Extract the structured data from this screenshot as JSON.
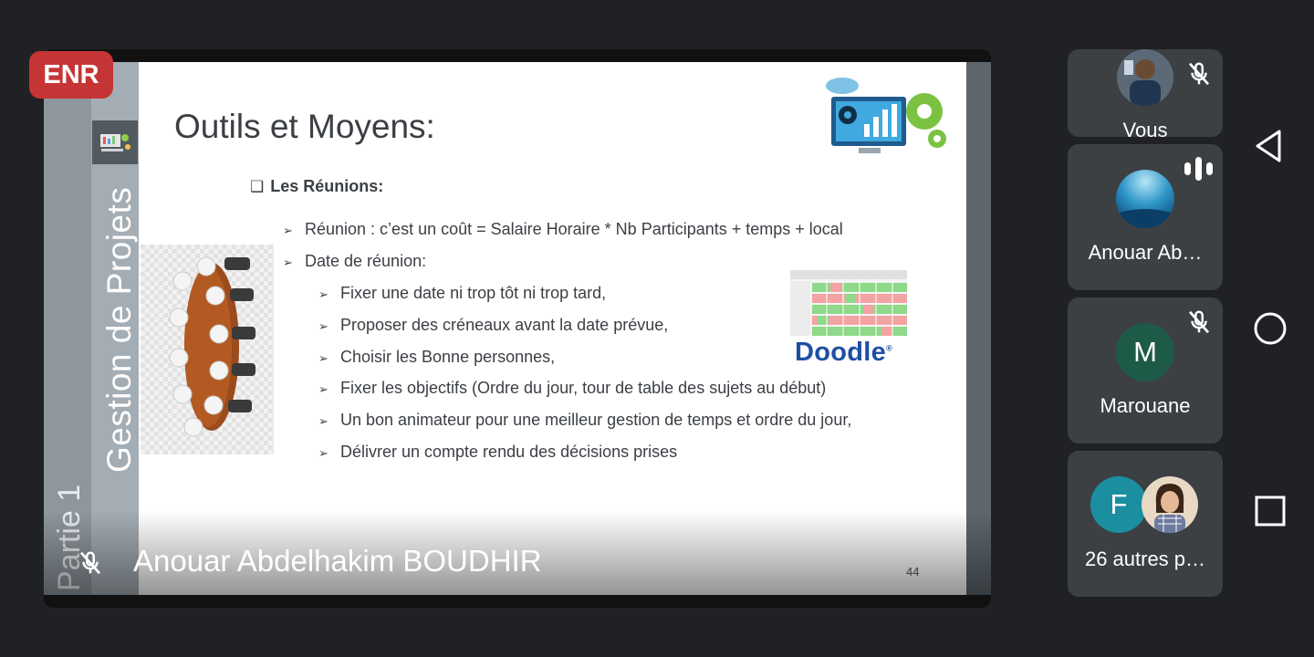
{
  "recording": {
    "badge_label": "ENR"
  },
  "slide": {
    "title": "Outils et Moyens:",
    "side_vertical_title": "Gestion de Projets",
    "side_vertical_part": "Partie 1",
    "section_heading": "Les Réunions:",
    "bullets": [
      "Réunion : c’est un coût =  Salaire Horaire * Nb Participants + temps + local",
      "Date de réunion:"
    ],
    "sub_bullets": [
      "Fixer une date ni trop tôt ni trop tard,",
      "Proposer des créneaux avant la date prévue,",
      "Choisir les Bonne personnes,",
      "Fixer les objectifs  (Ordre du jour, tour de table des sujets au début)",
      "Un bon animateur pour une meilleur gestion  de temps et ordre du jour,",
      "Délivrer un compte rendu des décisions prises"
    ],
    "doodle_logo": "Doodle",
    "doodle_mark": "®",
    "slide_number": "44"
  },
  "presenter": {
    "name": "Anouar Abdelhakim BOUDHIR",
    "mic_icon": "mic-off-icon"
  },
  "participants": [
    {
      "label": "Vous",
      "muted": true
    },
    {
      "label": "Anouar Ab…",
      "speaking": true
    },
    {
      "label": "Marouane",
      "initial": "M",
      "muted": true,
      "color": "#1e5a48"
    },
    {
      "label": "26 autres p…",
      "initial": "F",
      "color": "#1b8fa0"
    }
  ],
  "nav": {
    "back_icon": "back-triangle-icon",
    "home_icon": "home-circle-icon",
    "recents_icon": "recents-square-icon"
  },
  "colors": {
    "recording": "#c53535",
    "tile_bg": "#3c4043",
    "page_bg": "#202124",
    "doodle_blue": "#1d4fa3"
  }
}
